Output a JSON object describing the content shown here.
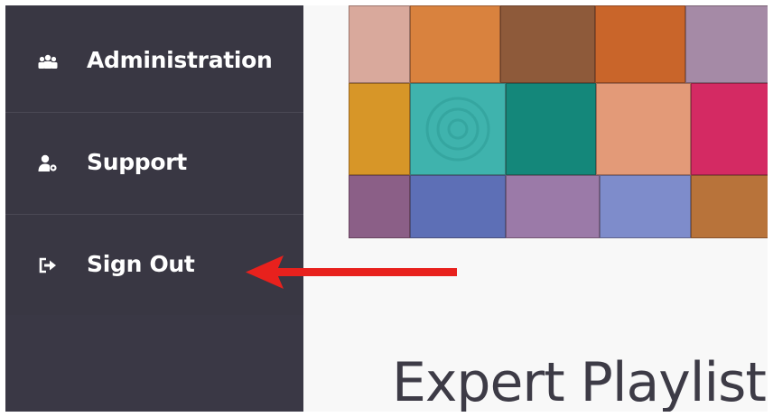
{
  "sidebar": {
    "items": [
      {
        "label": "Administration",
        "icon": "people-icon"
      },
      {
        "label": "Support",
        "icon": "user-gear-icon"
      },
      {
        "label": "Sign Out",
        "icon": "sign-out-icon"
      }
    ],
    "background": "#393743",
    "text_color": "#ffffff"
  },
  "main": {
    "title": "Expert Playlists",
    "hero_image": "colorful-wood-blocks"
  },
  "annotation": {
    "arrow_color": "#e8211d",
    "points_to": "sign-out-item"
  }
}
